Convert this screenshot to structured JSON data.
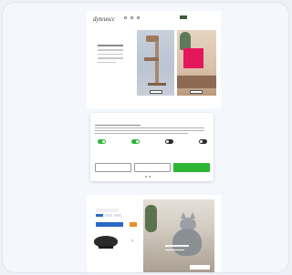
{
  "site": {
    "logo": "dyteuscc",
    "nav": [
      {
        "icon": "search-icon"
      },
      {
        "icon": "user-icon"
      },
      {
        "icon": "cart-icon"
      }
    ],
    "badge_color": "#3f5d3a"
  },
  "images": {
    "sale_color": "#e5175c"
  },
  "banner": {
    "toggles": [
      {
        "state": "on"
      },
      {
        "state": "on"
      },
      {
        "state": "off"
      },
      {
        "state": "off"
      }
    ],
    "accent_color": "#2db534"
  },
  "bottom": {
    "accent_color": "#2869c8"
  }
}
